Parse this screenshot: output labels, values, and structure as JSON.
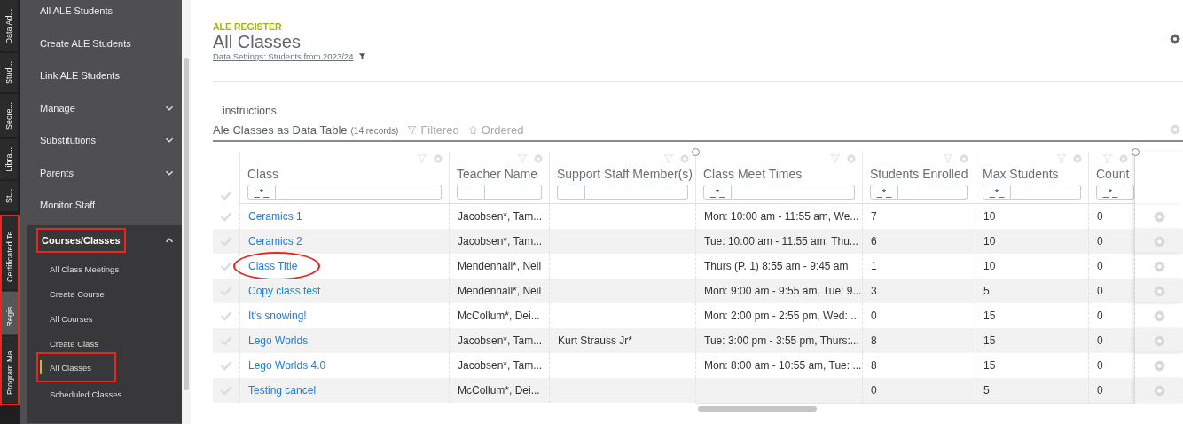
{
  "vertical_tabs": [
    {
      "label": "Data Ad...",
      "selected": false,
      "annotated": false
    },
    {
      "label": "Stud...",
      "selected": false,
      "annotated": false
    },
    {
      "label": "Secre...",
      "selected": false,
      "annotated": false
    },
    {
      "label": "Libra...",
      "selected": false,
      "annotated": false
    },
    {
      "label": "St...",
      "selected": false,
      "annotated": false
    },
    {
      "label": "Certificated Te...",
      "selected": false,
      "annotated": true
    },
    {
      "label": "Regis...",
      "selected": true,
      "annotated": true
    },
    {
      "label": "Program Ma...",
      "selected": false,
      "annotated": true
    }
  ],
  "sidebar": {
    "items": [
      {
        "kind": "link",
        "label": "All ALE Students"
      },
      {
        "kind": "link",
        "label": "Create ALE Students"
      },
      {
        "kind": "link",
        "label": "Link ALE Students"
      },
      {
        "kind": "group",
        "label": "Manage",
        "expanded": false
      },
      {
        "kind": "group",
        "label": "Substitutions",
        "expanded": false
      },
      {
        "kind": "group",
        "label": "Parents",
        "expanded": false
      },
      {
        "kind": "link",
        "label": "Monitor Staff"
      },
      {
        "kind": "group",
        "label": "Courses/Classes",
        "expanded": true,
        "annotated": true,
        "children": [
          {
            "label": "All Class Meetings",
            "selected": false,
            "annotated": false
          },
          {
            "label": "Create Course",
            "selected": false,
            "annotated": false
          },
          {
            "label": "All Courses",
            "selected": false,
            "annotated": false
          },
          {
            "label": "Create Class",
            "selected": false,
            "annotated": false
          },
          {
            "label": "All Classes",
            "selected": true,
            "annotated": true
          },
          {
            "label": "Scheduled Classes",
            "selected": false,
            "annotated": false
          }
        ]
      }
    ]
  },
  "header": {
    "eyebrow": "ALE REGISTER",
    "title": "All Classes",
    "data_settings": "Data Settings: Students from 2023/24"
  },
  "instructions": "instructions",
  "table": {
    "title": "Ale Classes as Data Table",
    "count": "(14 records)",
    "filtered_label": "Filtered",
    "ordered_label": "Ordered",
    "columns": [
      {
        "label": "Class",
        "filter_prefix": "_*_",
        "resize_handle": false
      },
      {
        "label": "Teacher Name",
        "resize_handle": false
      },
      {
        "label": "Support Staff Member(s)",
        "resize_handle": false
      },
      {
        "label": "Class Meet Times",
        "filter_prefix": "_*_",
        "resize_handle": true
      },
      {
        "label": "Students Enrolled",
        "filter_prefix": "_*_",
        "resize_handle": false
      },
      {
        "label": "Max Students",
        "filter_prefix": "_*_",
        "resize_handle": false
      },
      {
        "label": "Count",
        "filter_prefix": "_*_",
        "resize_handle": false
      }
    ],
    "frozen_handle": true,
    "rows": [
      {
        "checked": false,
        "annotated": false,
        "cells": [
          "Ceramics 1",
          "Jacobsen*, Tam...",
          "",
          "Mon: 10:00 am - 11:55 am, We...",
          "7",
          "10",
          "0"
        ]
      },
      {
        "checked": false,
        "annotated": false,
        "cells": [
          "Ceramics 2",
          "Jacobsen*, Tam...",
          "",
          "Tue: 10:00 am - 11:55 am, Thu...",
          "6",
          "10",
          "0"
        ]
      },
      {
        "checked": false,
        "annotated": true,
        "cells": [
          "Class Title",
          "Mendenhall*, Neil",
          "",
          "Thurs (P. 1) 8:55 am - 9:45 am",
          "1",
          "10",
          "0"
        ]
      },
      {
        "checked": false,
        "annotated": false,
        "cells": [
          "Copy class test",
          "Mendenhall*, Neil",
          "",
          "Mon: 9:00 am - 9:55 am, Tue: 9...",
          "3",
          "5",
          "0"
        ]
      },
      {
        "checked": false,
        "annotated": false,
        "cells": [
          "It's snowing!",
          "McCollum*, Dei...",
          "",
          "Mon: 2:00 pm - 2:55 pm, Wed: ...",
          "0",
          "15",
          "0"
        ]
      },
      {
        "checked": false,
        "annotated": false,
        "cells": [
          "Lego Worlds",
          "Jacobsen*, Tam...",
          "Kurt Strauss Jr*",
          "Tue: 3:00 pm - 3:55 pm, Thurs:...",
          "8",
          "15",
          "0"
        ]
      },
      {
        "checked": false,
        "annotated": false,
        "cells": [
          "Lego Worlds 4.0",
          "Jacobsen*, Tam...",
          "",
          "Mon: 8:00 am - 10:55 am, Tue: ...",
          "8",
          "15",
          "0"
        ]
      },
      {
        "checked": false,
        "annotated": false,
        "cells": [
          "Testing cancel",
          "McCollum*, Dei...",
          "",
          "",
          "0",
          "5",
          "0"
        ]
      }
    ]
  }
}
